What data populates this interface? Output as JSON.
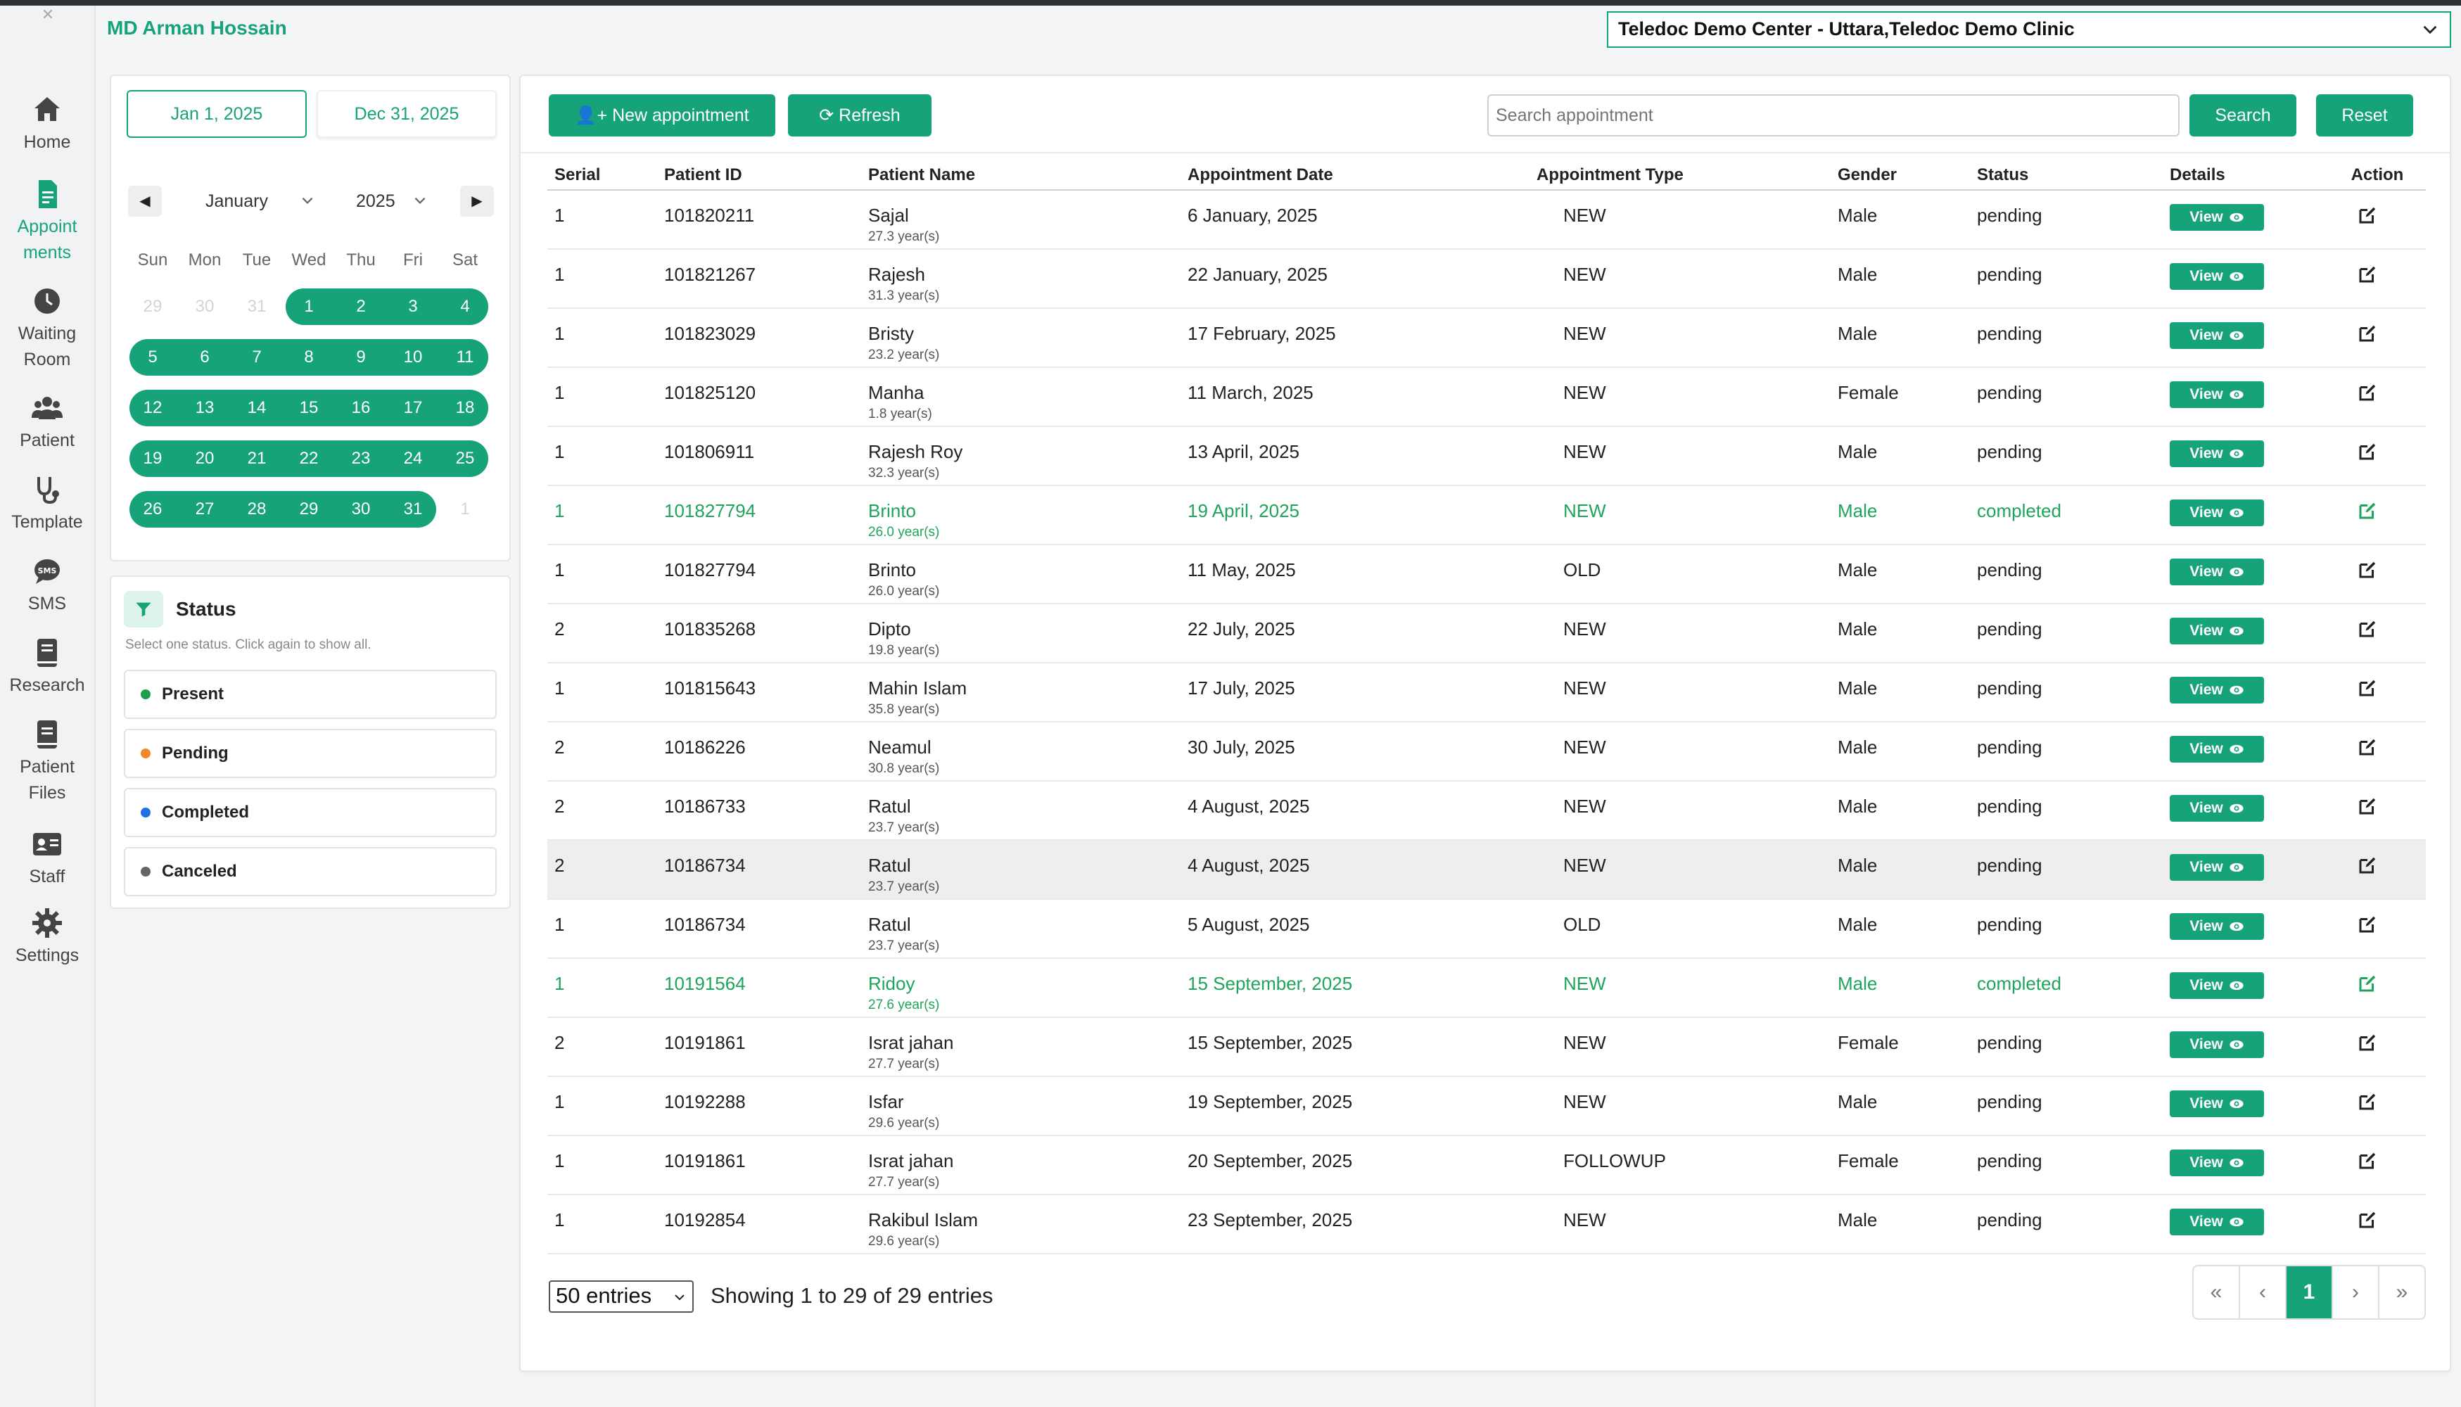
{
  "header": {
    "user_name": "MD Arman Hossain",
    "clinic": "Teledoc Demo Center - Uttara,Teledoc Demo Clinic"
  },
  "sidebar": {
    "items": [
      {
        "label": "Home",
        "icon": "home-icon"
      },
      {
        "label": "Appoint ments",
        "icon": "document-icon",
        "active": true
      },
      {
        "label": "Waiting Room",
        "icon": "clock-icon"
      },
      {
        "label": "Patient",
        "icon": "users-icon"
      },
      {
        "label": "Template",
        "icon": "stethoscope-icon"
      },
      {
        "label": "SMS",
        "icon": "sms-icon"
      },
      {
        "label": "Research",
        "icon": "book-icon"
      },
      {
        "label": "Patient Files",
        "icon": "file-icon"
      },
      {
        "label": "Staff",
        "icon": "id-card-icon"
      },
      {
        "label": "Settings",
        "icon": "gear-icon"
      }
    ]
  },
  "date_range": {
    "start": "Jan 1, 2025",
    "end": "Dec 31, 2025"
  },
  "calendar": {
    "month": "January",
    "year": "2025",
    "weekdays": [
      "Sun",
      "Mon",
      "Tue",
      "Wed",
      "Thu",
      "Fri",
      "Sat"
    ],
    "weeks": [
      [
        "29",
        "30",
        "31",
        "1",
        "2",
        "3",
        "4"
      ],
      [
        "5",
        "6",
        "7",
        "8",
        "9",
        "10",
        "11"
      ],
      [
        "12",
        "13",
        "14",
        "15",
        "16",
        "17",
        "18"
      ],
      [
        "19",
        "20",
        "21",
        "22",
        "23",
        "24",
        "25"
      ],
      [
        "26",
        "27",
        "28",
        "29",
        "30",
        "31",
        "1"
      ]
    ],
    "today": "29"
  },
  "status_filter": {
    "title": "Status",
    "hint": "Select one status. Click again to show all.",
    "options": [
      {
        "label": "Present",
        "color": "#1e9e4a"
      },
      {
        "label": "Pending",
        "color": "#f0892b"
      },
      {
        "label": "Completed",
        "color": "#1f6fe5"
      },
      {
        "label": "Canceled",
        "color": "#666666"
      }
    ]
  },
  "toolbar": {
    "new_label": "New appointment",
    "refresh_label": "Refresh",
    "search_placeholder": "Search appointment",
    "search_label": "Search",
    "reset_label": "Reset"
  },
  "table": {
    "columns": [
      "Serial",
      "Patient ID",
      "Patient Name",
      "Appointment Date",
      "Appointment Type",
      "Gender",
      "Status",
      "Details",
      "Action"
    ],
    "view_label": "View",
    "rows": [
      {
        "serial": "1",
        "id": "101820211",
        "name": "Sajal",
        "age": "27.3 year(s)",
        "date": "6 January, 2025",
        "type": "NEW",
        "gender": "Male",
        "status": "pending"
      },
      {
        "serial": "1",
        "id": "101821267",
        "name": "Rajesh",
        "age": "31.3 year(s)",
        "date": "22 January, 2025",
        "type": "NEW",
        "gender": "Male",
        "status": "pending"
      },
      {
        "serial": "1",
        "id": "101823029",
        "name": "Bristy",
        "age": "23.2 year(s)",
        "date": "17 February, 2025",
        "type": "NEW",
        "gender": "Male",
        "status": "pending"
      },
      {
        "serial": "1",
        "id": "101825120",
        "name": "Manha",
        "age": "1.8 year(s)",
        "date": "11 March, 2025",
        "type": "NEW",
        "gender": "Female",
        "status": "pending"
      },
      {
        "serial": "1",
        "id": "101806911",
        "name": "Rajesh Roy",
        "age": "32.3 year(s)",
        "date": "13 April, 2025",
        "type": "NEW",
        "gender": "Male",
        "status": "pending"
      },
      {
        "serial": "1",
        "id": "101827794",
        "name": "Brinto",
        "age": "26.0 year(s)",
        "date": "19 April, 2025",
        "type": "NEW",
        "gender": "Male",
        "status": "completed"
      },
      {
        "serial": "1",
        "id": "101827794",
        "name": "Brinto",
        "age": "26.0 year(s)",
        "date": "11 May, 2025",
        "type": "OLD",
        "gender": "Male",
        "status": "pending"
      },
      {
        "serial": "2",
        "id": "101835268",
        "name": "Dipto",
        "age": "19.8 year(s)",
        "date": "22 July, 2025",
        "type": "NEW",
        "gender": "Male",
        "status": "pending"
      },
      {
        "serial": "1",
        "id": "101815643",
        "name": "Mahin Islam",
        "age": "35.8 year(s)",
        "date": "17 July, 2025",
        "type": "NEW",
        "gender": "Male",
        "status": "pending"
      },
      {
        "serial": "2",
        "id": "10186226",
        "name": "Neamul",
        "age": "30.8 year(s)",
        "date": "30 July, 2025",
        "type": "NEW",
        "gender": "Male",
        "status": "pending"
      },
      {
        "serial": "2",
        "id": "10186733",
        "name": "Ratul",
        "age": "23.7 year(s)",
        "date": "4 August, 2025",
        "type": "NEW",
        "gender": "Male",
        "status": "pending"
      },
      {
        "serial": "2",
        "id": "10186734",
        "name": "Ratul",
        "age": "23.7 year(s)",
        "date": "4 August, 2025",
        "type": "NEW",
        "gender": "Male",
        "status": "pending"
      },
      {
        "serial": "1",
        "id": "10186734",
        "name": "Ratul",
        "age": "23.7 year(s)",
        "date": "5 August, 2025",
        "type": "OLD",
        "gender": "Male",
        "status": "pending"
      },
      {
        "serial": "1",
        "id": "10191564",
        "name": "Ridoy",
        "age": "27.6 year(s)",
        "date": "15 September, 2025",
        "type": "NEW",
        "gender": "Male",
        "status": "completed"
      },
      {
        "serial": "2",
        "id": "10191861",
        "name": "Israt jahan",
        "age": "27.7 year(s)",
        "date": "15 September, 2025",
        "type": "NEW",
        "gender": "Female",
        "status": "pending"
      },
      {
        "serial": "1",
        "id": "10192288",
        "name": "Isfar",
        "age": "29.6 year(s)",
        "date": "19 September, 2025",
        "type": "NEW",
        "gender": "Male",
        "status": "pending"
      },
      {
        "serial": "1",
        "id": "10191861",
        "name": "Israt jahan",
        "age": "27.7 year(s)",
        "date": "20 September, 2025",
        "type": "FOLLOWUP",
        "gender": "Female",
        "status": "pending"
      },
      {
        "serial": "1",
        "id": "10192854",
        "name": "Rakibul Islam",
        "age": "29.6 year(s)",
        "date": "23 September, 2025",
        "type": "NEW",
        "gender": "Male",
        "status": "pending"
      }
    ]
  },
  "footer": {
    "entries_label": "50 entries",
    "showing": "Showing 1 to 29 of 29 entries",
    "pager": [
      "«",
      "‹",
      "1",
      "›",
      "»"
    ],
    "current_page": "1"
  },
  "colors": {
    "accent": "#17a37a",
    "completed": "#1ea55b"
  }
}
